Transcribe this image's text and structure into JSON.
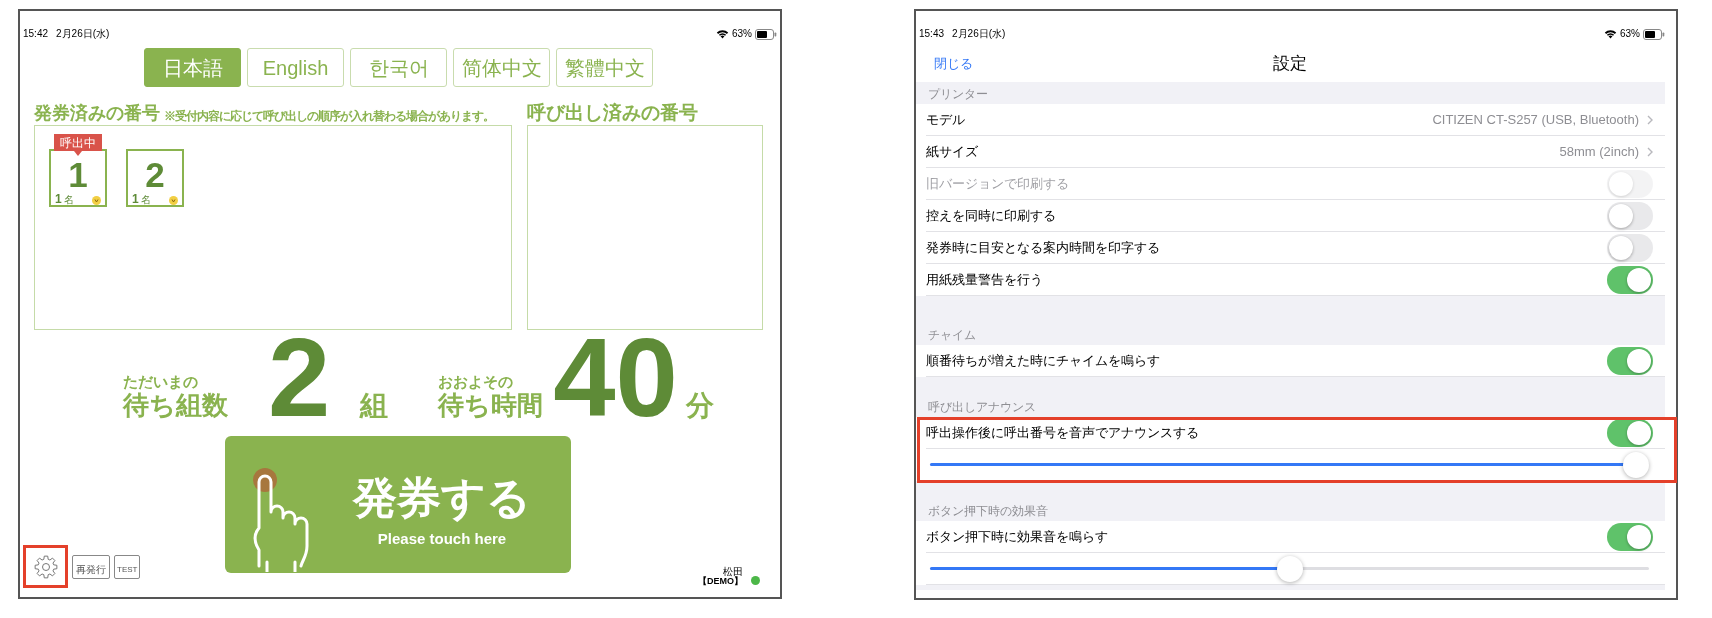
{
  "left_screen": {
    "status_bar": {
      "time": "15:42",
      "date": "2月26日(水)",
      "battery": "63%"
    },
    "language_tabs": [
      {
        "label": "日本語",
        "selected": true
      },
      {
        "label": "English",
        "selected": false
      },
      {
        "label": "한국어",
        "selected": false
      },
      {
        "label": "简体中文",
        "selected": false
      },
      {
        "label": "繁體中文",
        "selected": false
      }
    ],
    "issued_panel": {
      "title": "発券済みの番号",
      "note": "※受付内容に応じて呼び出しの順序が入れ替わる場合があります。",
      "tickets": [
        {
          "number": "1",
          "party_size": "1",
          "unit": "名",
          "calling": true,
          "calling_label": "呼出中"
        },
        {
          "number": "2",
          "party_size": "1",
          "unit": "名",
          "calling": false
        }
      ]
    },
    "called_panel": {
      "title": "呼び出し済みの番号"
    },
    "waiting": {
      "groups_caption": "ただいまの",
      "groups_label": "待ち組数",
      "groups_value": "2",
      "groups_unit": "組",
      "time_caption": "おおよその",
      "time_label": "待ち時間",
      "time_value": "40",
      "time_unit": "分"
    },
    "issue_button": {
      "label": "発券する",
      "sublabel": "Please touch here"
    },
    "tools": [
      {
        "kind": "settings",
        "highlighted": true
      },
      {
        "kind": "reissue",
        "label": "再発行",
        "highlighted": false
      },
      {
        "kind": "test",
        "label": "TEST",
        "highlighted": false
      }
    ],
    "footer": {
      "user": "松田",
      "mode": "【DEMO】",
      "online": true
    }
  },
  "right_screen": {
    "status_bar": {
      "time": "15:43",
      "date": "2月26日(水)",
      "battery": "63%"
    },
    "nav": {
      "close": "閉じる",
      "title": "設定"
    },
    "sections": [
      {
        "header": "プリンター",
        "highlighted": false,
        "rows": [
          {
            "kind": "value",
            "label": "モデル",
            "value": "CITIZEN CT-S257 (USB, Bluetooth)"
          },
          {
            "kind": "value",
            "label": "紙サイズ",
            "value": "58mm (2inch)"
          },
          {
            "kind": "toggle",
            "label": "旧バージョンで印刷する",
            "on": false,
            "disabled": true
          },
          {
            "kind": "toggle",
            "label": "控えを同時に印刷する",
            "on": false,
            "disabled": false
          },
          {
            "kind": "toggle",
            "label": "発券時に目安となる案内時間を印字する",
            "on": false,
            "disabled": false
          },
          {
            "kind": "toggle",
            "label": "用紙残量警告を行う",
            "on": true,
            "disabled": false
          }
        ]
      },
      {
        "header": "チャイム",
        "highlighted": false,
        "rows": [
          {
            "kind": "toggle",
            "label": "順番待ちが増えた時にチャイムを鳴らす",
            "on": true,
            "disabled": false
          }
        ]
      },
      {
        "header": "呼び出しアナウンス",
        "highlighted": true,
        "rows": [
          {
            "kind": "toggle",
            "label": "呼出操作後に呼出番号を音声でアナウンスする",
            "on": true,
            "disabled": false
          },
          {
            "kind": "slider",
            "level": 1
          }
        ]
      },
      {
        "header": "ボタン押下時の効果音",
        "highlighted": false,
        "rows": [
          {
            "kind": "toggle",
            "label": "ボタン押下時に効果音を鳴らす",
            "on": true,
            "disabled": false
          },
          {
            "kind": "slider",
            "level": 0.5
          }
        ]
      }
    ]
  }
}
